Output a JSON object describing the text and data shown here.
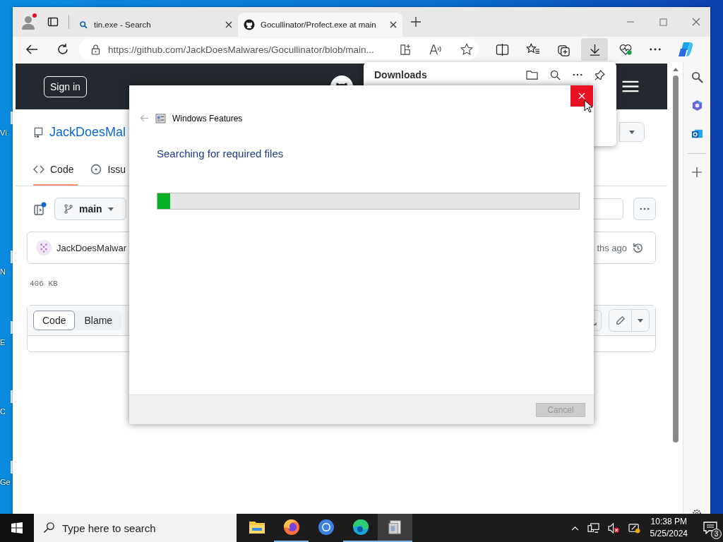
{
  "desktop": {
    "icon_labels": [
      "Vi",
      "N",
      "E",
      "C",
      "Ge"
    ]
  },
  "browser": {
    "tabs": [
      {
        "title": "tin.exe - Search",
        "kind": "search",
        "selected": false
      },
      {
        "title": "Gocullinator/Profect.exe at main",
        "kind": "github",
        "selected": true
      }
    ],
    "address": "https://github.com/JackDoesMalwares/Gocullinator/blob/main...",
    "downloads_selected": true,
    "downloads_panel": {
      "title": "Downloads"
    }
  },
  "github": {
    "sign_in": "Sign in",
    "repo": "JackDoesMal",
    "tabs": [
      {
        "label": "Code",
        "kind": "code",
        "selected": true
      },
      {
        "label": "Issu",
        "kind": "issues",
        "selected": false
      }
    ],
    "branch": "main",
    "author": "JackDoesMalwar",
    "time": "ths ago",
    "size": "406 KB",
    "view_tabs": [
      {
        "label": "Code",
        "selected": true
      },
      {
        "label": "Blame",
        "selected": false
      }
    ]
  },
  "dialog": {
    "title": "Windows Features",
    "heading": "Searching for required files",
    "progress": {
      "level": 0.03
    },
    "cancel": {
      "label": "Cancel",
      "disabled": true
    }
  },
  "taskbar": {
    "search_placeholder": "Type here to search",
    "apps": [
      {
        "kind": "explorer",
        "running": false,
        "selected": false
      },
      {
        "kind": "firefox",
        "running": true,
        "selected": false
      },
      {
        "kind": "chrome",
        "running": false,
        "selected": false
      },
      {
        "kind": "edge",
        "running": true,
        "selected": false
      },
      {
        "kind": "features",
        "running": true,
        "selected": true
      }
    ],
    "time": "10:38 PM",
    "date": "5/25/2024",
    "notifications": "3"
  }
}
